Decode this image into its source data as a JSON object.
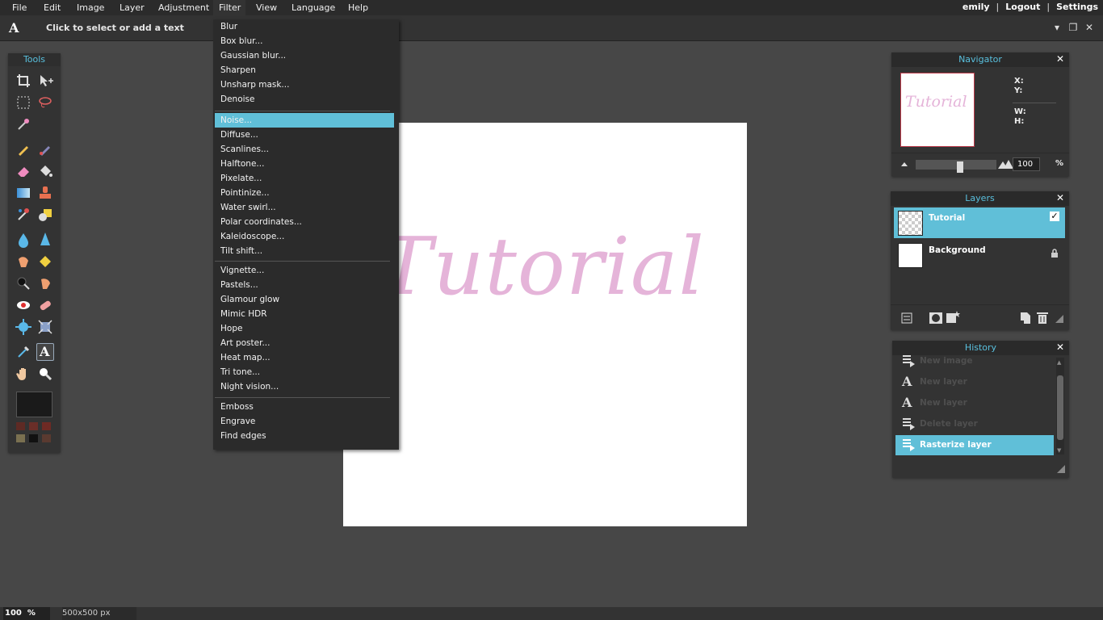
{
  "menubar": {
    "items": [
      "File",
      "Edit",
      "Image",
      "Layer",
      "Adjustment",
      "Filter",
      "View",
      "Language",
      "Help"
    ]
  },
  "user": {
    "name": "emily",
    "logout": "Logout",
    "settings": "Settings"
  },
  "optionsbar": {
    "tool_icon": "A",
    "hint": "Click to select or add a text"
  },
  "tools": {
    "title": "Tools"
  },
  "filter_menu": {
    "group1": [
      "Blur",
      "Box blur...",
      "Gaussian blur...",
      "Sharpen",
      "Unsharp mask...",
      "Denoise"
    ],
    "group2": [
      "Noise...",
      "Diffuse...",
      "Scanlines...",
      "Halftone...",
      "Pixelate...",
      "Pointinize...",
      "Water swirl...",
      "Polar coordinates...",
      "Kaleidoscope...",
      "Tilt shift..."
    ],
    "group3": [
      "Vignette...",
      "Pastels...",
      "Glamour glow",
      "Mimic HDR",
      "Hope",
      "Art poster...",
      "Heat map...",
      "Tri tone...",
      "Night vision..."
    ],
    "group4": [
      "Emboss",
      "Engrave",
      "Find edges"
    ],
    "highlighted": "Noise..."
  },
  "canvas": {
    "text": "Tutorial",
    "text_color": "#e5b4d9"
  },
  "navigator": {
    "title": "Navigator",
    "thumb_text": "Tutorial",
    "x_label": "X:",
    "y_label": "Y:",
    "w_label": "W:",
    "h_label": "H:",
    "zoom": "100",
    "zoom_unit": "%"
  },
  "layers": {
    "title": "Layers",
    "items": [
      {
        "name": "Tutorial",
        "selected": true,
        "visible": true
      },
      {
        "name": "Background",
        "locked": true
      }
    ]
  },
  "history": {
    "title": "History",
    "items": [
      {
        "label": "New image",
        "icon": "A"
      },
      {
        "label": "New layer",
        "icon": "A"
      },
      {
        "label": "New layer",
        "icon": "A"
      },
      {
        "label": "Delete layer",
        "icon": "A"
      },
      {
        "label": "Rasterize layer",
        "icon": "A"
      }
    ]
  },
  "status": {
    "zoom": "100",
    "zoom_unit": "%",
    "size": "500x500 px"
  },
  "colors": {
    "accent": "#60bfd8",
    "menubar": "#2b2b2b",
    "background": "#474747"
  }
}
